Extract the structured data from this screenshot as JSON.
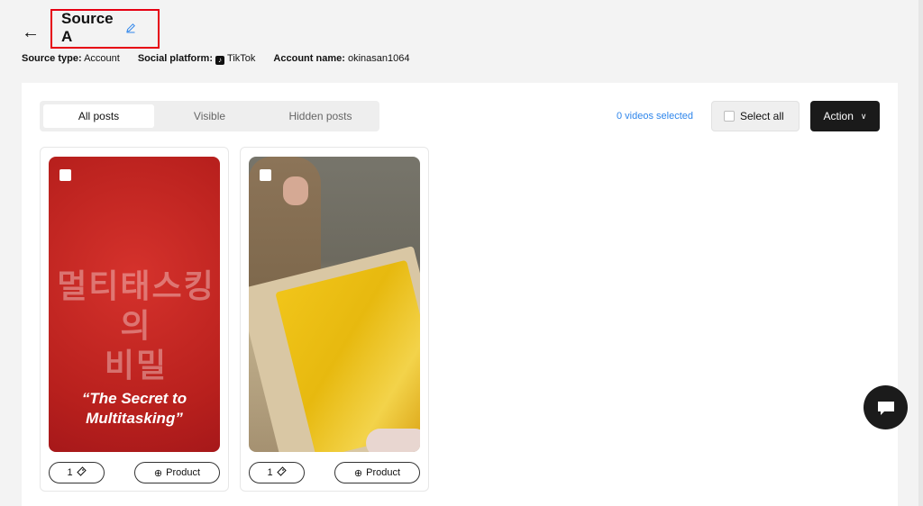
{
  "header": {
    "back_icon": "arrow-left-icon",
    "title": "Source A",
    "edit_icon": "pencil-icon"
  },
  "meta": {
    "source_type_label": "Source type",
    "source_type_value": "Account",
    "platform_label": "Social platform",
    "platform_value": "TikTok",
    "platform_icon": "tiktok-icon",
    "account_label": "Account name",
    "account_value": "okinasan1064"
  },
  "tabs": [
    {
      "label": "All posts",
      "active": true
    },
    {
      "label": "Visible",
      "active": false
    },
    {
      "label": "Hidden posts",
      "active": false
    }
  ],
  "toolbar": {
    "selected_text": "0 videos selected",
    "select_all_label": "Select all",
    "action_label": "Action"
  },
  "cards": [
    {
      "overlay_korean_line1": "멀티태스킹의",
      "overlay_korean_line2": "비밀",
      "overlay_quote_line1": "“The Secret to",
      "overlay_quote_line2": "Multitasking”",
      "tag_count": "1",
      "product_label": "Product"
    },
    {
      "tag_count": "1",
      "product_label": "Product"
    }
  ],
  "colors": {
    "accent_blue": "#2f86eb",
    "highlight_red": "#e60012",
    "action_black": "#1a1a1a"
  }
}
